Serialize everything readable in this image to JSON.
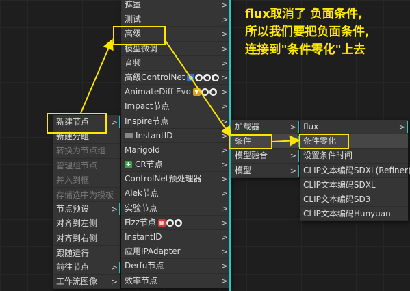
{
  "annotation": {
    "line1": "flux取消了 负面条件,",
    "line2": "所以我们要把负面条件,",
    "line3": "连接到\"条件零化\"上去"
  },
  "menu1": {
    "items": [
      {
        "label": "新建节点",
        "arrow": ">"
      },
      {
        "label": "新建分组"
      },
      {
        "label": "转换为节点组",
        "disabled": true
      },
      {
        "label": "管理组节点",
        "disabled": true
      },
      {
        "label": "并入到框",
        "disabled": true
      },
      {
        "label": "存储选中为模板",
        "disabled": true
      },
      {
        "label": "节点预设",
        "arrow": ">"
      },
      {
        "label": "对齐到左侧"
      },
      {
        "label": "对齐到右侧"
      },
      {
        "label": "跟随运行"
      },
      {
        "label": "前往节点",
        "arrow": ">"
      },
      {
        "label": "工作流图像",
        "arrow": ">"
      }
    ]
  },
  "menu2": {
    "items": [
      {
        "label": "遮罩",
        "arrow": ">"
      },
      {
        "label": "测试",
        "arrow": ">"
      },
      {
        "label": "高级",
        "arrow": ">"
      },
      {
        "label": "模型微调",
        "arrow": ">"
      },
      {
        "label": "音频",
        "arrow": ">"
      },
      {
        "label": "高级ControlNet",
        "arrow": ">"
      },
      {
        "label": "AnimateDiff Evo",
        "arrow": ">"
      },
      {
        "label": "Impact节点",
        "arrow": ">"
      },
      {
        "label": "Inspire节点",
        "arrow": ">"
      },
      {
        "label": "InstantID",
        "arrow": ">"
      },
      {
        "label": "Marigold",
        "arrow": ">"
      },
      {
        "label": "CR节点",
        "arrow": ">"
      },
      {
        "label": "ControlNet预处理器",
        "arrow": ">"
      },
      {
        "label": "Alek节点",
        "arrow": ">"
      },
      {
        "label": "实验节点",
        "arrow": ">"
      },
      {
        "label": "Fizz节点",
        "arrow": ">"
      },
      {
        "label": "InstantID",
        "arrow": ">"
      },
      {
        "label": "应用IPAdapter",
        "arrow": ">"
      },
      {
        "label": "Derfu节点",
        "arrow": ">"
      },
      {
        "label": "效率节点",
        "arrow": ">"
      }
    ]
  },
  "menu3": {
    "items": [
      {
        "label": "加载器",
        "arrow": ">"
      },
      {
        "label": "条件",
        "arrow": ">"
      },
      {
        "label": "模型融合",
        "arrow": ">"
      },
      {
        "label": "模型",
        "arrow": ">"
      }
    ]
  },
  "menu4": {
    "items": [
      {
        "label": "flux",
        "arrow": ">"
      },
      {
        "label": "条件零化"
      },
      {
        "label": "设置条件时间"
      },
      {
        "label": "CLIP文本编码SDXL(Refiner)"
      },
      {
        "label": "CLIP文本编码SDXL"
      },
      {
        "label": "CLIP文本编码SD3"
      },
      {
        "label": "CLIP文本编码Hunyuan"
      }
    ]
  },
  "colors": {
    "annotation": "#ffea00",
    "accent_bar": "#2ec4c4",
    "menu_bg": "#353535"
  }
}
